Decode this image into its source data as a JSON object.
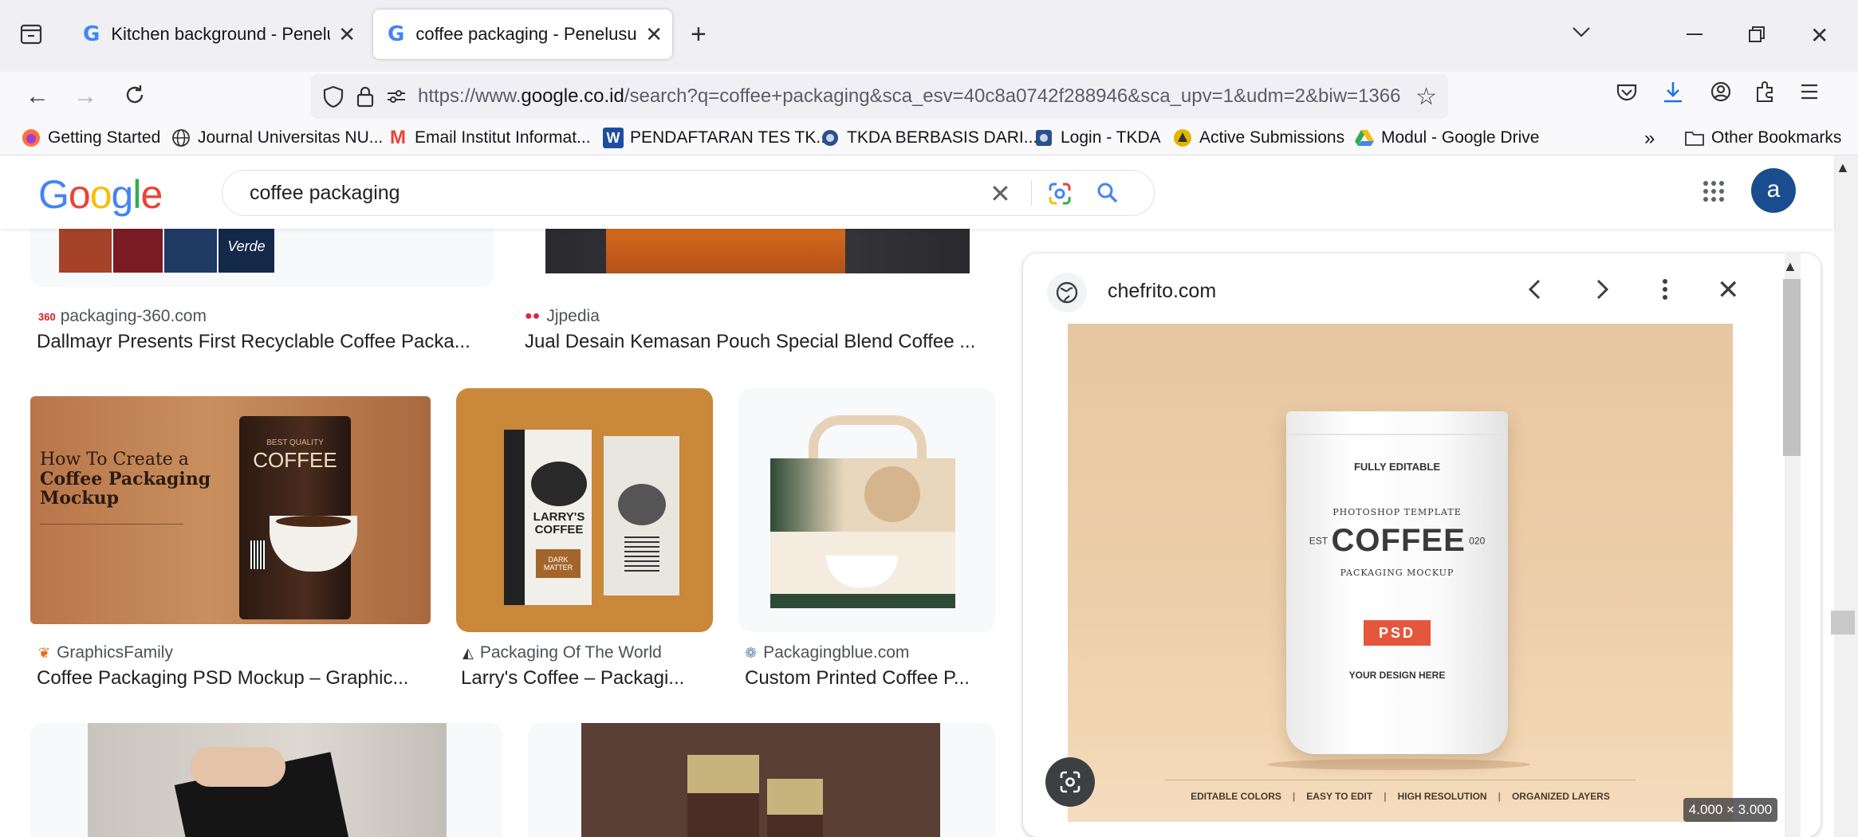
{
  "browser": {
    "tabs": [
      {
        "label": "Kitchen background - Penelusu",
        "icon": "google-g-icon",
        "active": false
      },
      {
        "label": "coffee packaging - Penelusuran",
        "icon": "google-g-icon",
        "active": true
      }
    ],
    "url_prefix": "https://www.",
    "url_domain": "google.co.id",
    "url_rest": "/search?q=coffee+packaging&sca_esv=40c8a0742f288946&sca_upv=1&udm=2&biw=1366",
    "bookmarks": [
      {
        "label": "Getting Started",
        "icon": "firefox-icon"
      },
      {
        "label": "Journal Universitas NU...",
        "icon": "globe-icon"
      },
      {
        "label": "Email Institut Informat...",
        "icon": "gmail-icon"
      },
      {
        "label": "PENDAFTARAN TES TK...",
        "icon": "w-logo-icon"
      },
      {
        "label": "TKDA BERBASIS DARI...",
        "icon": "seal-icon"
      },
      {
        "label": "Login - TKDA",
        "icon": "seal-icon"
      },
      {
        "label": "Active Submissions",
        "icon": "submission-icon"
      },
      {
        "label": "Modul - Google Drive",
        "icon": "drive-icon"
      }
    ],
    "other_bookmarks": "Other Bookmarks"
  },
  "google": {
    "logo": "Google",
    "query": "coffee packaging",
    "avatar_letter": "a"
  },
  "results": [
    {
      "source": "packaging-360.com",
      "caption": "Dallmayr Presents First Recyclable Coffee Packa..."
    },
    {
      "source": "Jjpedia",
      "caption": "Jual Desain Kemasan Pouch Special Blend Coffee ..."
    },
    {
      "source": "GraphicsFamily",
      "caption": "Coffee Packaging PSD Mockup – Graphic..."
    },
    {
      "source": "Packaging Of The World",
      "caption": "Larry's Coffee – Packagi..."
    },
    {
      "source": "Packagingblue.com",
      "caption": "Custom Printed Coffee P..."
    }
  ],
  "thumb_text": {
    "mockup_line1": "How To Create a",
    "mockup_line2": "Coffee Packaging",
    "mockup_line3": "Mockup",
    "best_quality": "BEST QUALITY",
    "coffee": "COFFEE",
    "larrys": "LARRY'S",
    "larrys2": "COFFEE",
    "dark_matter": "DARK MATTER",
    "verde": "Verde"
  },
  "panel": {
    "domain": "chefrito.com",
    "dimensions": "4.000 × 3.000",
    "bag": {
      "fully_editable": "FULLY EDITABLE",
      "arc_top": "PHOTOSHOP TEMPLATE",
      "est": "EST",
      "coffee": "COFFEE",
      "year": "020",
      "arc_bottom": "PACKAGING MOCKUP",
      "psd": "PSD",
      "your_design": "YOUR DESIGN HERE"
    },
    "features": [
      "EDITABLE COLORS",
      "EASY TO EDIT",
      "HIGH RESOLUTION",
      "ORGANIZED LAYERS"
    ]
  },
  "colors": {
    "google_blue": "#4285F4",
    "google_red": "#EA4335",
    "google_yellow": "#FBBC05",
    "google_green": "#34A853",
    "psd_badge": "#e4573d"
  }
}
